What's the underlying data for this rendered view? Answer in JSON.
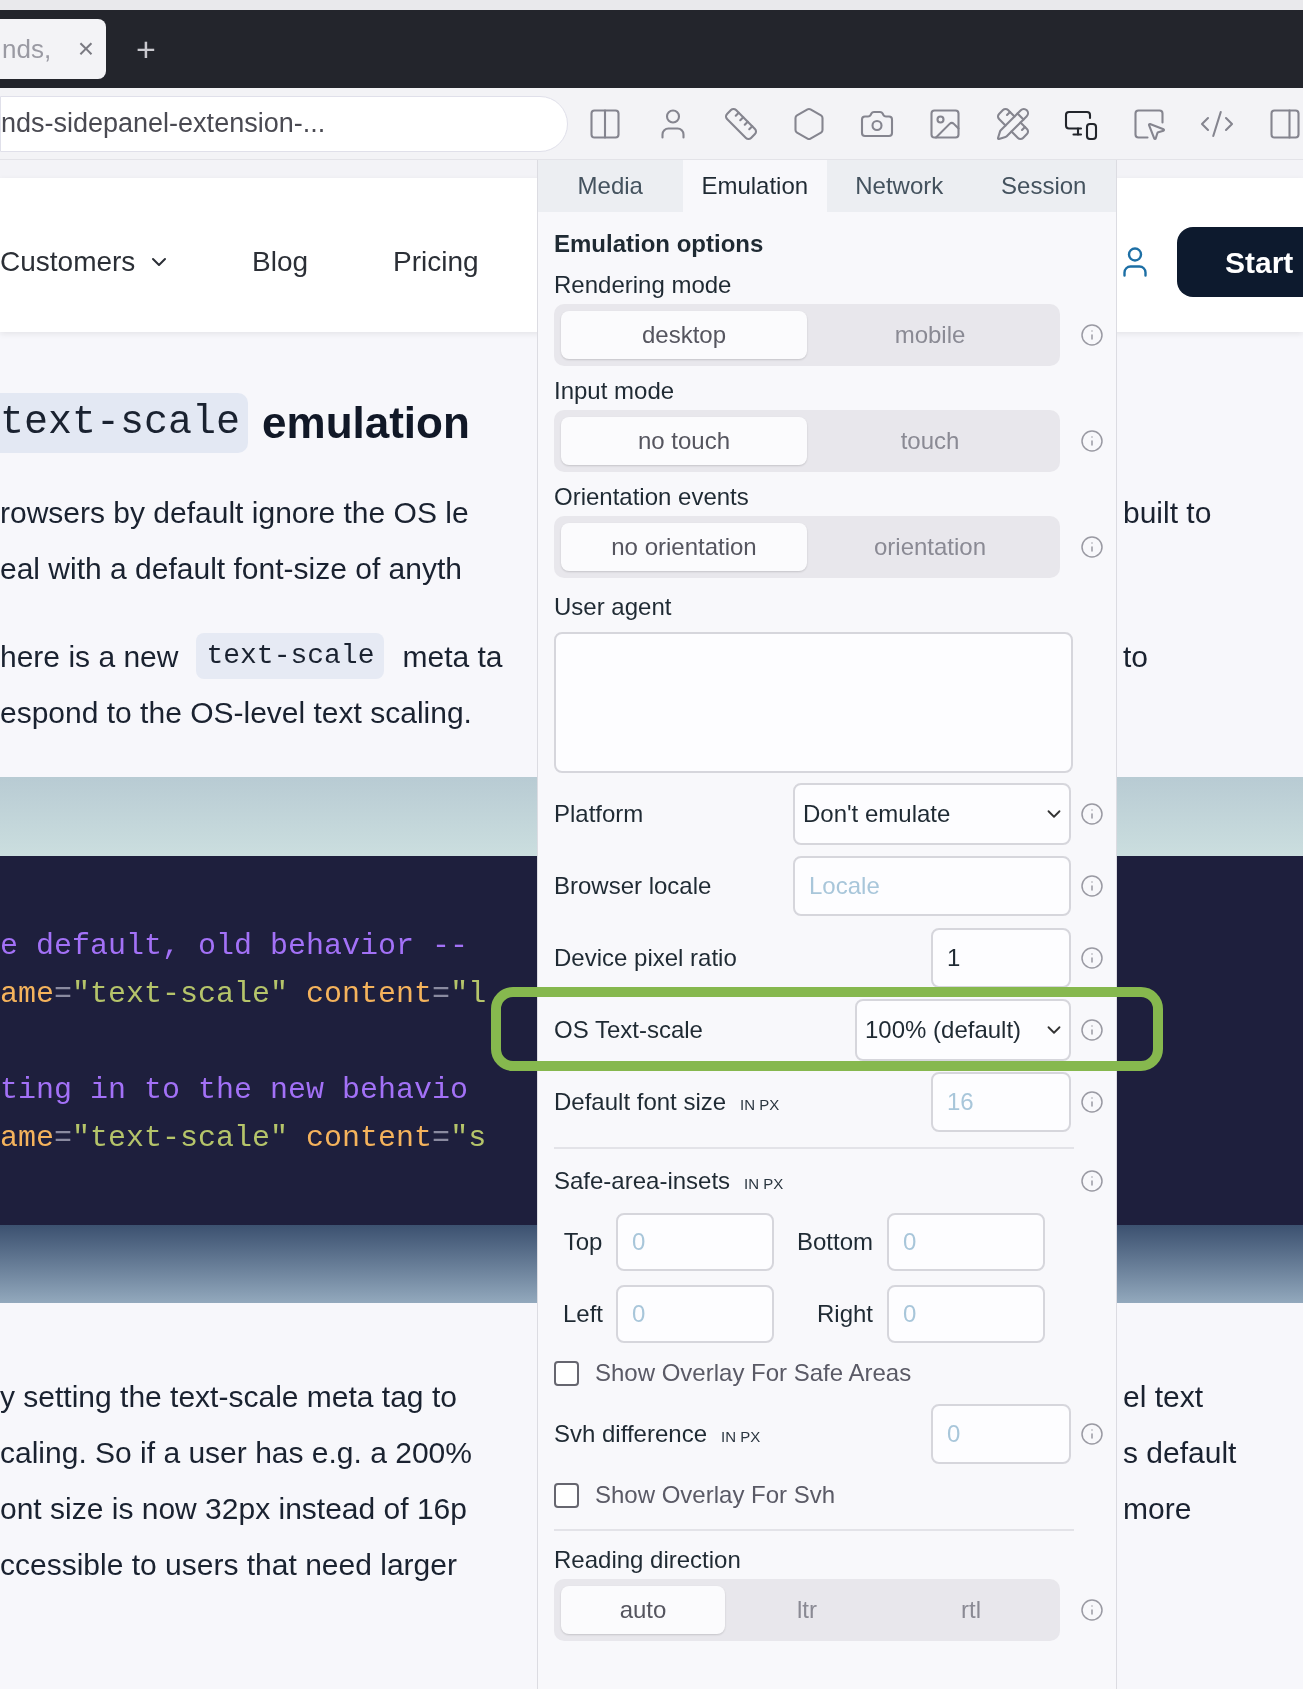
{
  "browser": {
    "tab": {
      "title": "nds,",
      "close": "×"
    },
    "new_tab": "+",
    "address": "nds-sidepanel-extension-...",
    "toolbar": [
      {
        "kind": "columns",
        "selected": false
      },
      {
        "kind": "person",
        "selected": false
      },
      {
        "kind": "ruler",
        "selected": false
      },
      {
        "kind": "hexagon",
        "selected": false
      },
      {
        "kind": "camera",
        "selected": false
      },
      {
        "kind": "image",
        "selected": false
      },
      {
        "kind": "tools",
        "selected": false
      },
      {
        "kind": "devices",
        "selected": true
      },
      {
        "kind": "pointer",
        "selected": false
      },
      {
        "kind": "code",
        "selected": false
      },
      {
        "kind": "sidebar",
        "selected": false
      }
    ]
  },
  "page": {
    "nav": {
      "items": [
        {
          "label": "Customers",
          "dropdown": true
        },
        {
          "label": "Blog",
          "dropdown": false
        },
        {
          "label": "Pricing",
          "dropdown": false
        }
      ],
      "start_button": "Start"
    },
    "heading": {
      "code": "text-scale",
      "text": "emulation"
    },
    "intro": [
      {
        "segments": [
          {
            "kind": "text",
            "text": "rowsers by default ignore the OS le"
          }
        ],
        "right": "built to"
      },
      {
        "segments": [
          {
            "kind": "text",
            "text": "eal with a default font-size of anyth"
          }
        ]
      }
    ],
    "para2": [
      {
        "segments": [
          {
            "kind": "text",
            "text": "here is a new"
          },
          {
            "kind": "code",
            "text": "text-scale"
          },
          {
            "kind": "text",
            "text": "meta ta"
          }
        ],
        "right": "to"
      },
      {
        "segments": [
          {
            "kind": "text",
            "text": "espond to the OS-level text scaling."
          }
        ]
      }
    ],
    "code": [
      {
        "kind": "code",
        "tokens": [
          {
            "kind": "comment",
            "text": "e default, old behavior --"
          }
        ]
      },
      {
        "kind": "code",
        "tokens": [
          {
            "kind": "attr",
            "text": "ame"
          },
          {
            "kind": "op",
            "text": "="
          },
          {
            "kind": "string",
            "text": "\"text-scale\""
          },
          {
            "kind": "attr",
            "text": " content"
          },
          {
            "kind": "op",
            "text": "="
          },
          {
            "kind": "string",
            "text": "\"l"
          }
        ]
      },
      {
        "kind": "blank"
      },
      {
        "kind": "code",
        "tokens": [
          {
            "kind": "comment",
            "text": "ting in to the new behavio"
          }
        ]
      },
      {
        "kind": "code",
        "tokens": [
          {
            "kind": "attr",
            "text": "ame"
          },
          {
            "kind": "op",
            "text": "="
          },
          {
            "kind": "string",
            "text": "\"text-scale\""
          },
          {
            "kind": "attr",
            "text": " content"
          },
          {
            "kind": "op",
            "text": "="
          },
          {
            "kind": "string",
            "text": "\"s"
          }
        ]
      }
    ],
    "outro": [
      {
        "left": "y setting the text-scale meta tag to",
        "right": "el text"
      },
      {
        "left": "caling. So if a user has e.g. a 200%",
        "right": "s default"
      },
      {
        "left": "ont size is now 32px instead of 16p",
        "right": "more"
      },
      {
        "left": "ccessible to users that need larger"
      }
    ]
  },
  "panel": {
    "tabs": [
      {
        "label": "Media",
        "selected": false
      },
      {
        "label": "Emulation",
        "selected": true
      },
      {
        "label": "Network",
        "selected": false
      },
      {
        "label": "Session",
        "selected": false
      }
    ],
    "title": "Emulation options",
    "sections": [
      {
        "kind": "segmented",
        "label": "Rendering mode",
        "options": [
          {
            "label": "desktop",
            "selected": true
          },
          {
            "label": "mobile",
            "selected": false
          }
        ]
      },
      {
        "kind": "segmented",
        "label": "Input mode",
        "options": [
          {
            "label": "no touch",
            "selected": true
          },
          {
            "label": "touch",
            "selected": false
          }
        ]
      },
      {
        "kind": "segmented",
        "label": "Orientation events",
        "options": [
          {
            "label": "no orientation",
            "selected": true
          },
          {
            "label": "orientation",
            "selected": false
          }
        ]
      },
      {
        "kind": "textarea",
        "label": "User agent"
      },
      {
        "kind": "select",
        "label": "Platform",
        "value": "Don't emulate",
        "highlighted": false
      },
      {
        "kind": "text",
        "label": "Browser locale",
        "placeholder": "Locale"
      },
      {
        "kind": "number",
        "label": "Device pixel ratio",
        "value": "1"
      },
      {
        "kind": "select",
        "label": "OS Text-scale",
        "value": "100% (default)",
        "highlighted": true
      },
      {
        "kind": "number",
        "label": "Default font size",
        "unit": "IN PX",
        "placeholder": "16"
      },
      {
        "kind": "divider"
      },
      {
        "kind": "insets",
        "label": "Safe-area-insets",
        "unit": "IN PX",
        "fields": [
          {
            "label": "Top",
            "placeholder": "0"
          },
          {
            "label": "Bottom",
            "placeholder": "0"
          },
          {
            "label": "Left",
            "placeholder": "0"
          },
          {
            "label": "Right",
            "placeholder": "0"
          }
        ]
      },
      {
        "kind": "checkbox",
        "label": "Show Overlay For Safe Areas",
        "checked": false
      },
      {
        "kind": "number",
        "label": "Svh difference",
        "unit": "IN PX",
        "placeholder": "0"
      },
      {
        "kind": "checkbox",
        "label": "Show Overlay For Svh",
        "checked": false
      },
      {
        "kind": "divider"
      },
      {
        "kind": "segmented",
        "label": "Reading direction",
        "options": [
          {
            "label": "auto",
            "selected": true
          },
          {
            "label": "ltr",
            "selected": false
          },
          {
            "label": "rtl",
            "selected": false
          }
        ]
      }
    ]
  }
}
